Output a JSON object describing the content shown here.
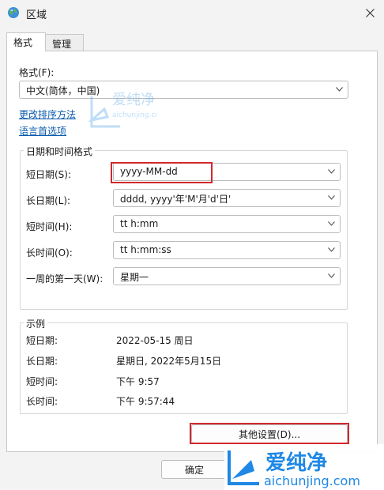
{
  "window": {
    "title": "区域"
  },
  "tabs": [
    {
      "label": "格式",
      "active": true
    },
    {
      "label": "管理",
      "active": false
    }
  ],
  "format": {
    "label": "格式(F):",
    "selected": "中文(简体，中国)"
  },
  "links": {
    "sort_method": "更改排序方法",
    "language_prefs": "语言首选项"
  },
  "datetime": {
    "title": "日期和时间格式",
    "rows": [
      {
        "label": "短日期(S):",
        "value": "yyyy-MM-dd"
      },
      {
        "label": "长日期(L):",
        "value": "dddd, yyyy'年'M'月'd'日'"
      },
      {
        "label": "短时间(H):",
        "value": "tt h:mm"
      },
      {
        "label": "长时间(O):",
        "value": "tt h:mm:ss"
      },
      {
        "label": "一周的第一天(W):",
        "value": "星期一"
      }
    ]
  },
  "examples": {
    "title": "示例",
    "rows": [
      {
        "label": "短日期:",
        "value": "2022-05-15 周日"
      },
      {
        "label": "长日期:",
        "value": "星期日, 2022年5月15日"
      },
      {
        "label": "短时间:",
        "value": "下午 9:57"
      },
      {
        "label": "长时间:",
        "value": "下午 9:57:44"
      }
    ]
  },
  "buttons": {
    "other_settings": "其他设置(D)...",
    "ok": "确定"
  },
  "watermark": {
    "brand": "爱纯净",
    "url": "aichunjing.com"
  },
  "colors": {
    "link": "#0b5cad",
    "highlight": "#d0282d",
    "watermark": "#1e88e5"
  }
}
